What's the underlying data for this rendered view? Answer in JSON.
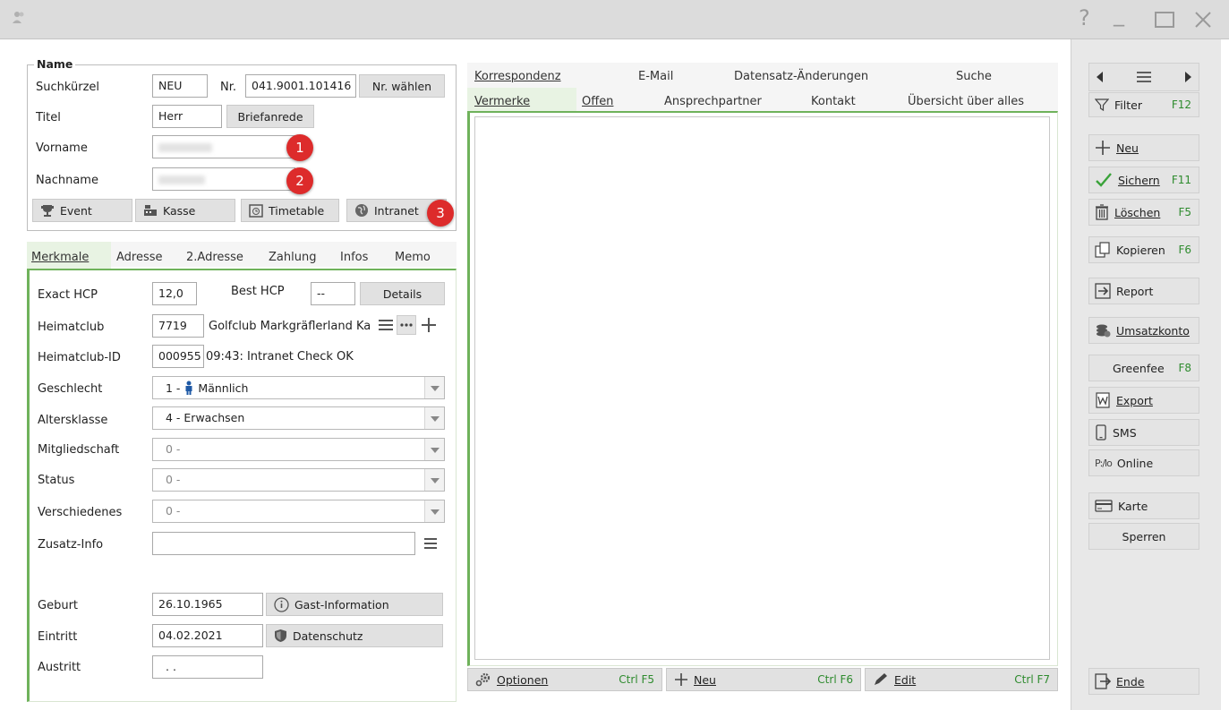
{
  "titlebar": {
    "help": "?",
    "minimize": "_"
  },
  "name_group": {
    "legend": "Name",
    "suchkuerzel_label": "Suchkürzel",
    "suchkuerzel_value": "NEU",
    "nr_label": "Nr.",
    "nr_value": "041.9001.101416",
    "nr_waehlen": "Nr. wählen",
    "titel_label": "Titel",
    "titel_value": "Herr",
    "briefanrede": "Briefanrede",
    "vorname_label": "Vorname",
    "nachname_label": "Nachname",
    "buttons": {
      "event": "Event",
      "kasse": "Kasse",
      "timetable": "Timetable",
      "intranet": "Intranet"
    },
    "badges": [
      "1",
      "2",
      "3"
    ]
  },
  "detail_tabs": [
    "Merkmale",
    "Adresse",
    "2.Adresse",
    "Zahlung",
    "Infos",
    "Memo"
  ],
  "merkmale": {
    "exact_hcp_label": "Exact HCP",
    "exact_hcp_value": "12,0",
    "best_hcp_label": "Best HCP",
    "best_hcp_value": "--",
    "details": "Details",
    "heimatclub_label": "Heimatclub",
    "heimatclub_nr": "7719",
    "heimatclub_name": "Golfclub Markgräflerland Ka",
    "heimatclub_id_label": "Heimatclub-ID",
    "heimatclub_id_value": "000955",
    "heimatclub_id_status": "09:43: Intranet Check OK",
    "geschlecht_label": "Geschlecht",
    "geschlecht_value_prefix": "1 -",
    "geschlecht_value": "Männlich",
    "altersklasse_label": "Altersklasse",
    "altersklasse_value": "4 - Erwachsen",
    "mitgliedschaft_label": "Mitgliedschaft",
    "mitgliedschaft_value": "0 -",
    "status_label": "Status",
    "status_value": "0 -",
    "verschiedenes_label": "Verschiedenes",
    "verschiedenes_value": "0 -",
    "zusatz_label": "Zusatz-Info",
    "geburt_label": "Geburt",
    "geburt_value": "26.10.1965",
    "gast_info": "Gast-Information",
    "eintritt_label": "Eintritt",
    "eintritt_value": "04.02.2021",
    "datenschutz": "Datenschutz",
    "austritt_label": "Austritt",
    "austritt_value": ". ."
  },
  "main_tabs_row1": [
    "Korrespondenz",
    "E-Mail",
    "Datensatz-Änderungen",
    "Suche"
  ],
  "main_tabs_row2": [
    "Vermerke",
    "Offen",
    "Ansprechpartner",
    "Kontakt",
    "Übersicht über alles"
  ],
  "bottom_bar": {
    "optionen": "Optionen",
    "optionen_key": "Ctrl F5",
    "neu": "Neu",
    "neu_key": "Ctrl F6",
    "edit": "Edit",
    "edit_key": "Ctrl F7"
  },
  "sidebar": {
    "filter": "Filter",
    "filter_key": "F12",
    "neu": "Neu",
    "sichern": "Sichern",
    "sichern_key": "F11",
    "loeschen": "Löschen",
    "loeschen_key": "F5",
    "kopieren": "Kopieren",
    "kopieren_key": "F6",
    "report": "Report",
    "umsatzkonto": "Umsatzkonto",
    "greenfee": "Greenfee",
    "greenfee_key": "F8",
    "export": "Export",
    "sms": "SMS",
    "online": "Online",
    "karte": "Karte",
    "sperren": "Sperren",
    "ende": "Ende"
  },
  "colors": {
    "accent_green": "#2e8b2e",
    "badge_red": "#dd2b2b",
    "tab_active": "#e8f3e3"
  }
}
